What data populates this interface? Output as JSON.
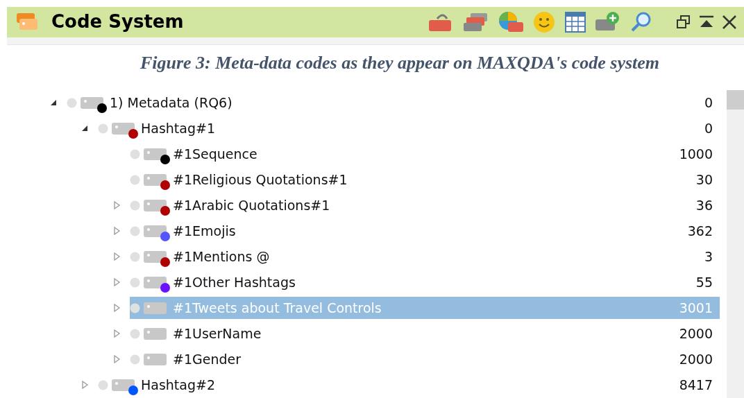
{
  "panel": {
    "title": "Code System"
  },
  "caption": "Figure 3: Meta-data codes as they appear on MAXQDA's code system",
  "tree": [
    {
      "label": "1) Metadata (RQ6)",
      "count": "0",
      "color": "#000000",
      "expanded": true,
      "selected": false,
      "children": [
        {
          "label": "Hashtag#1",
          "count": "0",
          "color": "#b00000",
          "expanded": true,
          "selected": false,
          "children": [
            {
              "label": "#1Sequence",
              "count": "1000",
              "color": "#000000",
              "selected": false
            },
            {
              "label": "#1Religious Quotations#1",
              "count": "30",
              "color": "#b00000",
              "selected": false
            },
            {
              "label": "#1Arabic Quotations#1",
              "count": "36",
              "color": "#b00000",
              "expanded": false,
              "selected": false
            },
            {
              "label": "#1Emojis",
              "count": "362",
              "color": "#5555ff",
              "expanded": false,
              "selected": false
            },
            {
              "label": "#1Mentions @",
              "count": "3",
              "color": "#b00000",
              "expanded": false,
              "selected": false
            },
            {
              "label": "#1Other Hashtags",
              "count": "55",
              "color": "#6a11ff",
              "expanded": false,
              "selected": false
            },
            {
              "label": "#1Tweets about Travel Controls",
              "count": "3001",
              "expanded": false,
              "selected": true
            },
            {
              "label": "#1UserName",
              "count": "2000",
              "expanded": false,
              "selected": false
            },
            {
              "label": "#1Gender",
              "count": "2000",
              "expanded": false,
              "selected": false
            }
          ]
        },
        {
          "label": "Hashtag#2",
          "count": "8417",
          "color": "#0055ff",
          "expanded": false,
          "selected": false
        }
      ]
    }
  ]
}
